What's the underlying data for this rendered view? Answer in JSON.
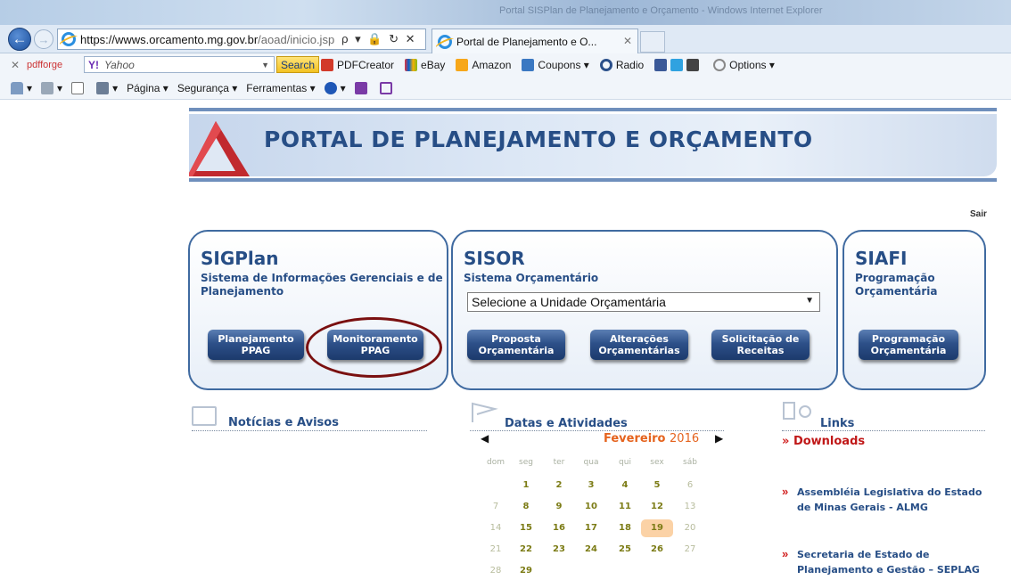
{
  "browser": {
    "window_title": "Portal SISPlan de Planejamento e Orçamento - Windows Internet Explorer",
    "url_main": "https://wwws.orcamento.mg.gov.br",
    "url_path": "/aoad/inicio.jsp",
    "address_icons": "ρ ▾ 🔒 ↻ ✕",
    "tab_title": "Portal de Planejamento e O...",
    "tab_close": "✕",
    "toolbar1": {
      "close": "✕",
      "pdfforge": "pdfforge",
      "yahoo_logo": "Y!",
      "yahoo_text": "Yahoo",
      "search_label": "Search",
      "items": [
        "PDFCreator",
        "eBay",
        "Amazon",
        "Coupons ▾",
        "Radio",
        "Options ▾"
      ]
    },
    "toolbar2": {
      "items": [
        "Página ▾",
        "Segurança ▾",
        "Ferramentas ▾"
      ]
    }
  },
  "portal": {
    "title": "PORTAL DE PLANEJAMENTO E ORÇAMENTO",
    "sair": "Sair",
    "sigplan": {
      "title": "SIGPlan",
      "subtitle": "Sistema de Informações Gerenciais e de Planejamento",
      "btn_planejamento": "Planejamento\nPPAG",
      "btn_monitoramento": "Monitoramento\nPPAG"
    },
    "sisor": {
      "title": "SISOR",
      "subtitle": "Sistema Orçamentário",
      "select_value": "Selecione a Unidade Orçamentária",
      "btn_proposta": "Proposta\nOrçamentária",
      "btn_alteracoes": "Alterações\nOrçamentárias",
      "btn_solicitacao": "Solicitação de\nReceitas"
    },
    "siafi": {
      "title": "SIAFI",
      "subtitle": "Programação Orçamentária",
      "btn_programacao": "Programação\nOrçamentária"
    },
    "noticias": {
      "title": "Notícias e Avisos"
    },
    "datas": {
      "title": "Datas e Atividades",
      "month": "Fevereiro",
      "year": "2016",
      "weekdays": [
        "dom",
        "seg",
        "ter",
        "qua",
        "qui",
        "sex",
        "sáb"
      ],
      "weeks": [
        [
          "",
          "1",
          "2",
          "3",
          "4",
          "5",
          "6"
        ],
        [
          "7",
          "8",
          "9",
          "10",
          "11",
          "12",
          "13"
        ],
        [
          "14",
          "15",
          "16",
          "17",
          "18",
          "19",
          "20"
        ],
        [
          "21",
          "22",
          "23",
          "24",
          "25",
          "26",
          "27"
        ],
        [
          "28",
          "29",
          "",
          "",
          "",
          "",
          ""
        ]
      ],
      "highlighted_day": "19"
    },
    "links": {
      "title": "Links",
      "downloads": "Downloads",
      "almg": "Assembléia Legislativa do Estado de Minas Gerais - ALMG",
      "seplag": "Secretaria de Estado de Planejamento e Gestão – SEPLAG"
    }
  },
  "colors": {
    "brand_blue": "#274e86",
    "button_blue": "#2d5089",
    "accent_orange": "#e5631e",
    "highlight_ring": "#7a1010"
  }
}
